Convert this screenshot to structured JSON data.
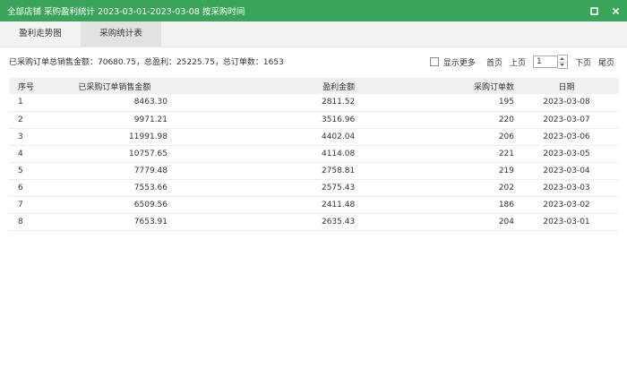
{
  "window": {
    "title": "全部店铺  采购盈利统计  2023-03-01-2023-03-08  按采购时间"
  },
  "tabs": [
    {
      "label": "盈利走势图",
      "active": false
    },
    {
      "label": "采购统计表",
      "active": true
    }
  ],
  "summary": "已采购订单总销售金额：70680.75，总盈利：25225.75，总订单数：1653",
  "pager": {
    "show_more_label": "显示更多",
    "first_label": "首页",
    "prev_label": "上页",
    "page_value": "1",
    "next_label": "下页",
    "last_label": "尾页"
  },
  "table": {
    "headers": [
      "序号",
      "已采购订单销售金额",
      "盈利金额",
      "采购订单数",
      "日期"
    ],
    "rows": [
      [
        "1",
        "8463.30",
        "2811.52",
        "195",
        "2023-03-08"
      ],
      [
        "2",
        "9971.21",
        "3516.96",
        "220",
        "2023-03-07"
      ],
      [
        "3",
        "11991.98",
        "4402.04",
        "206",
        "2023-03-06"
      ],
      [
        "4",
        "10757.65",
        "4114.08",
        "221",
        "2023-03-05"
      ],
      [
        "5",
        "7779.48",
        "2758.81",
        "219",
        "2023-03-04"
      ],
      [
        "6",
        "7553.66",
        "2575.43",
        "202",
        "2023-03-03"
      ],
      [
        "7",
        "6509.56",
        "2411.48",
        "186",
        "2023-03-02"
      ],
      [
        "8",
        "7653.91",
        "2635.43",
        "204",
        "2023-03-01"
      ]
    ]
  }
}
